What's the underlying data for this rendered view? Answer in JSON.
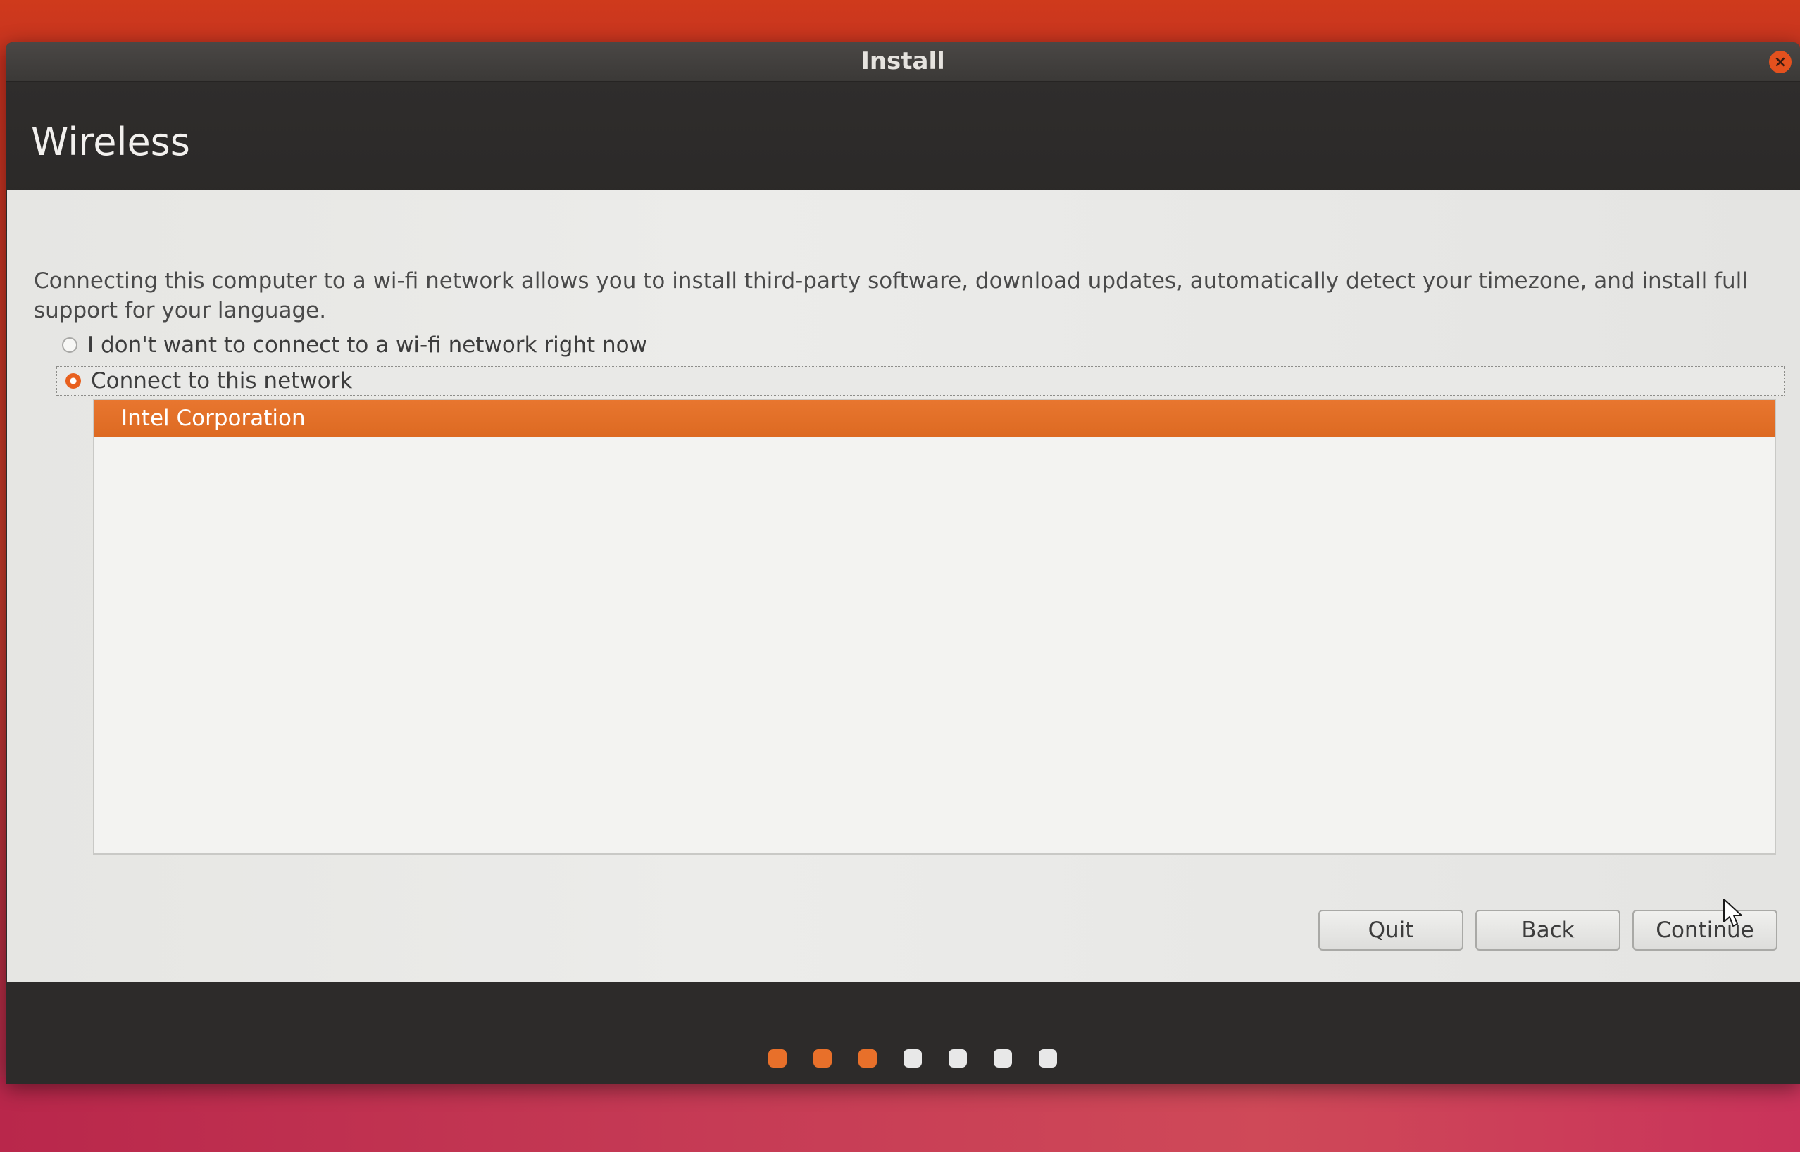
{
  "window": {
    "title": "Install",
    "close_icon": "close-icon"
  },
  "page": {
    "title": "Wireless",
    "description": "Connecting this computer to a wi-fi network allows you to install third-party software, download updates, automatically detect your timezone, and install full support for your language."
  },
  "options": {
    "no_connect_label": "I don't want to connect to a wi-fi network right now",
    "connect_label": "Connect to this network",
    "selected": "connect"
  },
  "networks": [
    {
      "name": "Intel Corporation",
      "selected": true
    }
  ],
  "buttons": {
    "quit": "Quit",
    "back": "Back",
    "continue": "Continue"
  },
  "progress": {
    "total_steps": 7,
    "completed_steps": 3,
    "active_color": "#e8702a",
    "inactive_color": "#e8e8e8"
  },
  "colors": {
    "accent": "#e8702a",
    "header_bg": "#2e2c2b",
    "content_bg": "#ebebe9"
  }
}
